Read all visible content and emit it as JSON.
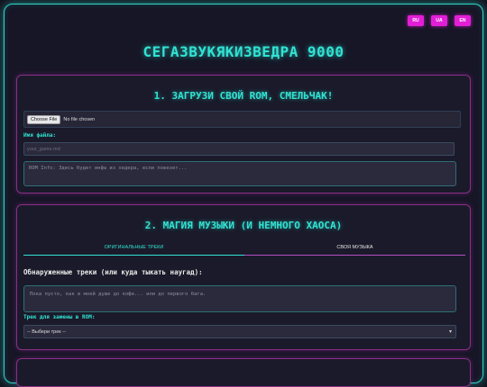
{
  "languages": [
    "RU",
    "UA",
    "EN"
  ],
  "app_title": "СЕГАЗВУКЯКИЗВЕДРА 9000",
  "step1": {
    "title": "1. ЗАГРУЗИ СВОЙ ROM, СМЕЛЬЧАК!",
    "choose_file_label": "Choose File",
    "file_status": "No file chosen",
    "filename_label": "Имя файла:",
    "filename_placeholder": "your_game.md",
    "rom_info": "ROM Info: Здесь будет инфа из хедера, если повезет..."
  },
  "step2": {
    "title": "2. МАГИЯ МУЗЫКИ (И НЕМНОГО ХАОСА)",
    "tabs": [
      "ОРИГИНАЛЬНЫЕ ТРЕКИ",
      "СВОЯ МУЗЫКА"
    ],
    "detected_heading": "Обнаруженные треки (или куда тыкать наугад):",
    "tracks_placeholder": "Пока пусто, как в моей душе до кофе... или до первого бага.",
    "replace_label": "Трек для замены в ROM:",
    "select_value": "-- Выбери трек --"
  },
  "colors": {
    "accent": "#31e3d3",
    "pink": "#e21fd7",
    "background": "#13131f"
  }
}
